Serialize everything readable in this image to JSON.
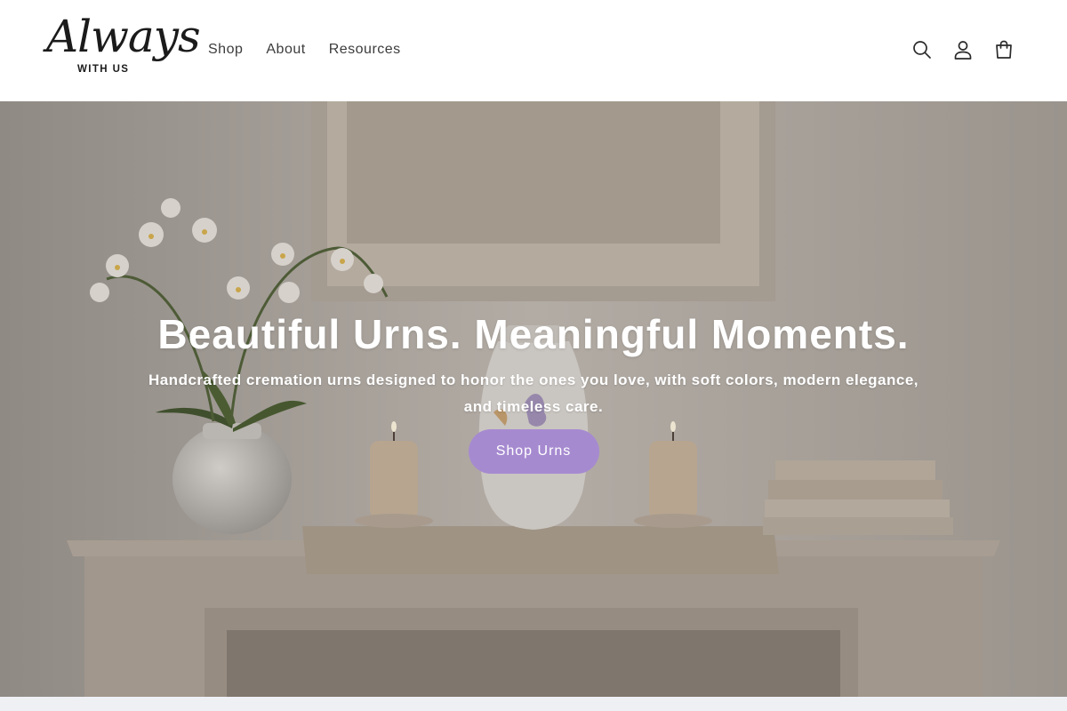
{
  "brand": {
    "logo_script": "Always",
    "logo_sub": "WITH US"
  },
  "nav": {
    "items": [
      {
        "label": "Shop"
      },
      {
        "label": "About"
      },
      {
        "label": "Resources"
      }
    ]
  },
  "header_icons": [
    "search-icon",
    "account-icon",
    "cart-icon"
  ],
  "hero": {
    "title": "Beautiful Urns. Meaningful Moments.",
    "subtitle": "Handcrafted cremation urns designed to honor the ones you love, with soft colors, modern elegance, and timeless care.",
    "cta_label": "Shop Urns"
  },
  "colors": {
    "cta": "#a68ad0",
    "header_bg": "#ffffff",
    "strip": "#eef0f4"
  }
}
